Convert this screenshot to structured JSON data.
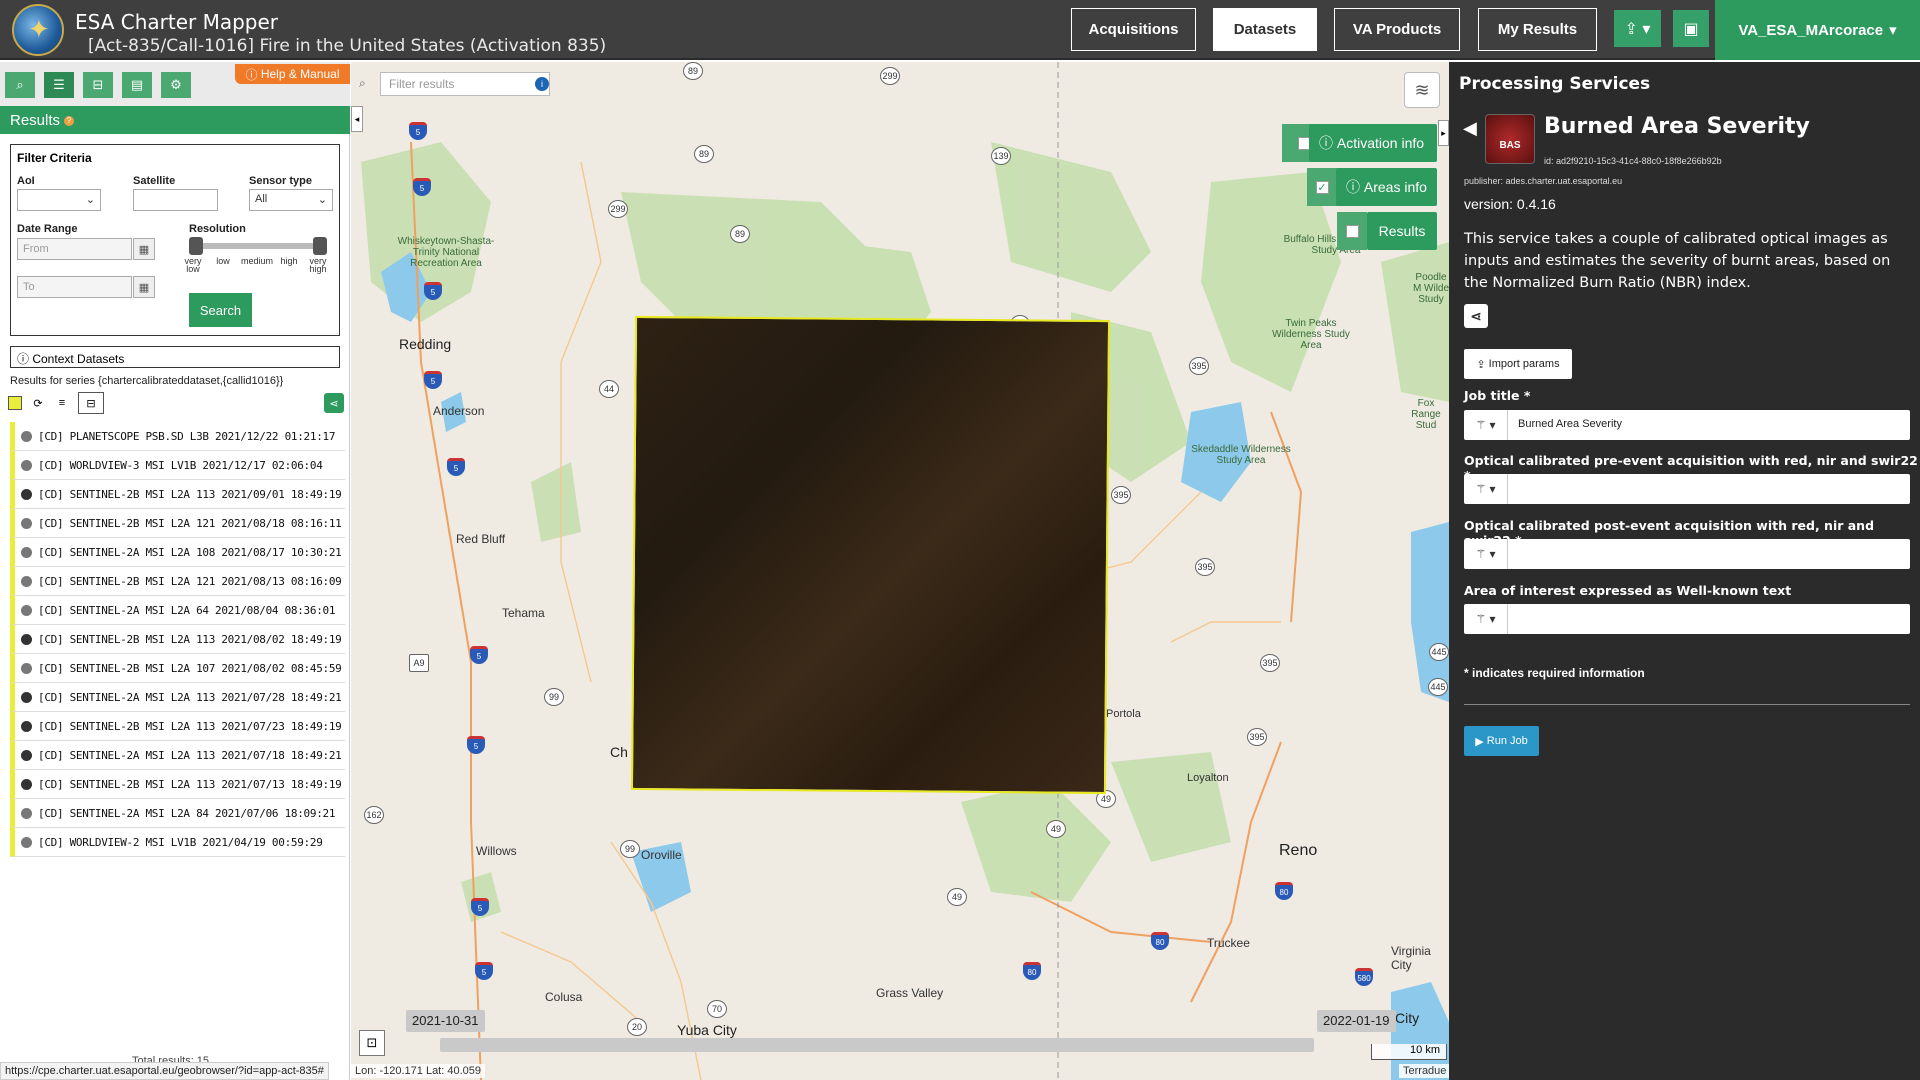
{
  "header": {
    "app_title": "ESA Charter Mapper",
    "activation_title": "[Act-835/Call-1016] Fire in the United States (Activation 835)",
    "nav": [
      "Acquisitions",
      "Datasets",
      "VA Products",
      "My Results"
    ],
    "active_nav": "Datasets",
    "user": "VA_ESA_MArcorace"
  },
  "left": {
    "help_label": "Help & Manual",
    "results_label": "Results",
    "filter": {
      "title": "Filter Criteria",
      "aoi_label": "AoI",
      "satellite_label": "Satellite",
      "sensor_label": "Sensor type",
      "sensor_value": "All",
      "date_label": "Date Range",
      "from_placeholder": "From",
      "to_placeholder": "To",
      "resolution_label": "Resolution",
      "res_ticks": [
        "very low",
        "low",
        "medium",
        "high",
        "very high"
      ],
      "search_label": "Search"
    },
    "context_label": "Context Datasets",
    "series_text": "Results for series {chartercalibrateddataset,{callid1016}}",
    "datasets": [
      "[CD] PLANETSCOPE PSB.SD L3B 2021/12/22 01:21:17",
      "[CD] WORLDVIEW-3 MSI LV1B 2021/12/17 02:06:04",
      "[CD] SENTINEL-2B MSI L2A 113 2021/09/01 18:49:19",
      "[CD] SENTINEL-2B MSI L2A 121 2021/08/18 08:16:11",
      "[CD] SENTINEL-2A MSI L2A 108 2021/08/17 10:30:21",
      "[CD] SENTINEL-2B MSI L2A 121 2021/08/13 08:16:09",
      "[CD] SENTINEL-2A MSI L2A 64 2021/08/04 08:36:01",
      "[CD] SENTINEL-2B MSI L2A 113 2021/08/02 18:49:19",
      "[CD] SENTINEL-2B MSI L2A 107 2021/08/02 08:45:59",
      "[CD] SENTINEL-2A MSI L2A 113 2021/07/28 18:49:21",
      "[CD] SENTINEL-2B MSI L2A 113 2021/07/23 18:49:19",
      "[CD] SENTINEL-2A MSI L2A 113 2021/07/18 18:49:21",
      "[CD] SENTINEL-2B MSI L2A 113 2021/07/13 18:49:19",
      "[CD] SENTINEL-2A MSI L2A 84 2021/07/06 18:09:21",
      "[CD] WORLDVIEW-2 MSI LV1B 2021/04/19 00:59:29"
    ],
    "total_results": "Total results: 15",
    "url": "https://cpe.charter.uat.esaportal.eu/geobrowser/?id=app-act-835#"
  },
  "map": {
    "filter_placeholder": "Filter results",
    "activation_info": "Activation info",
    "areas_info": "Areas info",
    "results_toggle": "Results",
    "date_start": "2021-10-31",
    "date_end": "2022-01-19",
    "scale": "10 km",
    "coords": "Lon: -120.171 Lat: 40.059",
    "attribution": "Terradue",
    "labels": {
      "redding": "Redding",
      "anderson": "Anderson",
      "red_bluff": "Red Bluff",
      "tehama": "Tehama",
      "willows": "Willows",
      "oroville": "Oroville",
      "colusa": "Colusa",
      "yuba_city": "Yuba City",
      "grass_valley": "Grass Valley",
      "truckee": "Truckee",
      "reno": "Reno",
      "virginia_city": "Virginia City",
      "loyalton": "Loyalton",
      "portola": "Portola",
      "chico_partial": "Ch",
      "city_partial": "City",
      "whiskeytown": "Whiskeytown-Shasta-Trinity National Recreation Area",
      "buffalo_hills": "Buffalo Hills Wilderness Study Area",
      "twin_peaks": "Twin Peaks Wilderness Study Area",
      "skedaddle": "Skedaddle Wilderness Study Area",
      "poodle": "Poodle M Wilde Study",
      "fox_range": "Fox Range Stud"
    }
  },
  "right": {
    "panel_title": "Processing Services",
    "service_name": "Burned Area Severity",
    "service_abbr": "BAS",
    "service_id": "id: ad2f9210-15c3-41c4-88c0-18f8e266b92b",
    "publisher": "publisher: ades.charter.uat.esaportal.eu",
    "version": "version: 0.4.16",
    "description": "This service takes a couple of calibrated optical images as inputs and estimates the severity of burnt areas, based on the Normalized Burn Ratio (NBR) index.",
    "import_label": "Import params",
    "params": [
      {
        "label": "Job title *",
        "value": "Burned Area Severity"
      },
      {
        "label": "Optical calibrated pre-event acquisition with red, nir and swir22 *",
        "value": ""
      },
      {
        "label": "Optical calibrated post-event acquisition with red, nir and swir22 *",
        "value": ""
      },
      {
        "label": "Area of interest expressed as Well-known text",
        "value": ""
      }
    ],
    "required_note": "* indicates required information",
    "run_label": "Run Job"
  }
}
